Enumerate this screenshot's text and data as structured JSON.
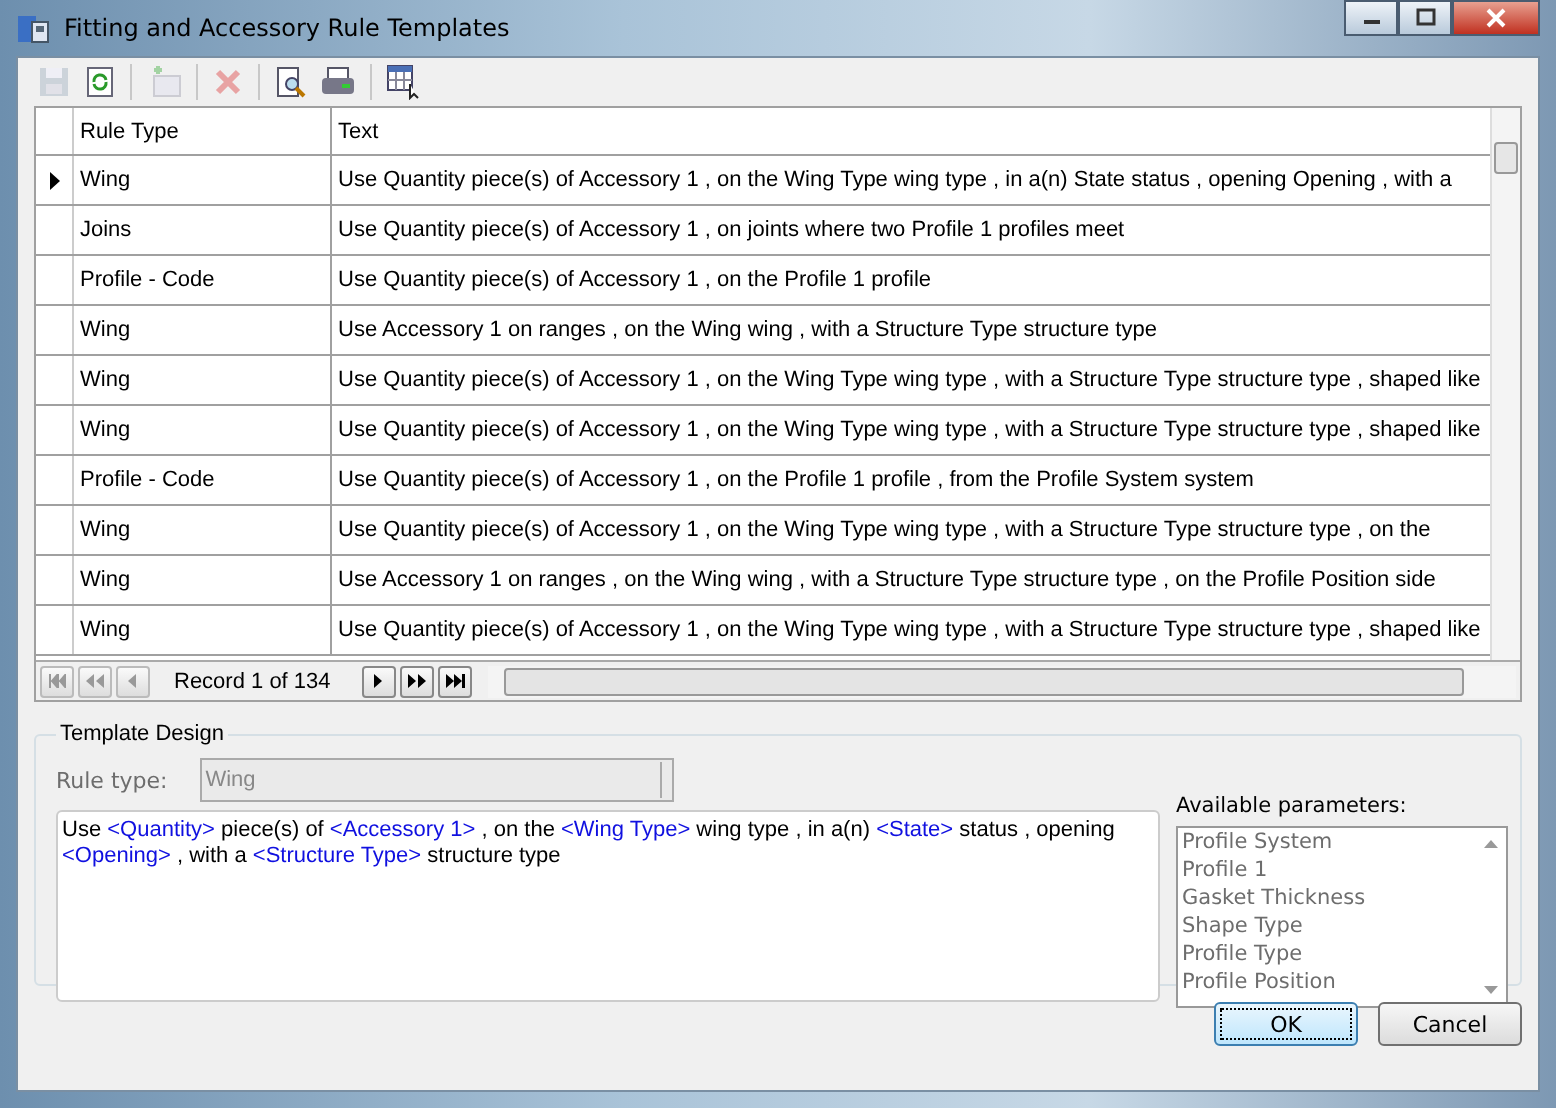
{
  "window": {
    "title": "Fitting and Accessory Rule Templates"
  },
  "toolbar": [
    {
      "kind": "save",
      "disabled": true
    },
    {
      "kind": "refresh",
      "disabled": false
    },
    {
      "kind": "separator"
    },
    {
      "kind": "add",
      "disabled": true
    },
    {
      "kind": "separator"
    },
    {
      "kind": "delete",
      "disabled": true
    },
    {
      "kind": "separator"
    },
    {
      "kind": "preview",
      "disabled": false
    },
    {
      "kind": "print",
      "disabled": false
    },
    {
      "kind": "separator"
    },
    {
      "kind": "columns",
      "disabled": false
    }
  ],
  "table": {
    "columns": [
      "Rule Type",
      "Text"
    ],
    "rows": [
      {
        "rule_type": "Wing",
        "text": "Use Quantity piece(s) of Accessory 1 , on the Wing Type wing type , in a(n) State status , opening Opening , with a",
        "selected": true
      },
      {
        "rule_type": "Joins",
        "text": "Use Quantity piece(s) of Accessory 1 , on joints where two Profile 1 profiles meet",
        "selected": false
      },
      {
        "rule_type": "Profile - Code",
        "text": "Use Quantity piece(s) of Accessory 1 , on the Profile 1 profile",
        "selected": false
      },
      {
        "rule_type": "Wing",
        "text": "Use Accessory 1 on ranges , on the Wing wing , with a Structure Type structure type",
        "selected": false
      },
      {
        "rule_type": "Wing",
        "text": "Use Quantity piece(s) of Accessory 1 , on the Wing Type wing type , with a Structure Type structure type , shaped like",
        "selected": false
      },
      {
        "rule_type": "Wing",
        "text": "Use Quantity piece(s) of Accessory 1 , on the Wing Type wing type , with a Structure Type structure type , shaped like",
        "selected": false
      },
      {
        "rule_type": "Profile - Code",
        "text": "Use Quantity piece(s) of Accessory 1 , on the Profile 1 profile , from the Profile System system",
        "selected": false
      },
      {
        "rule_type": "Wing",
        "text": "Use Quantity piece(s) of Accessory 1 , on the Wing Type wing type , with a Structure Type structure type , on the",
        "selected": false
      },
      {
        "rule_type": "Wing",
        "text": "Use Accessory 1 on ranges , on the Wing wing , with a Structure Type structure type , on the Profile Position side",
        "selected": false
      },
      {
        "rule_type": "Wing",
        "text": "Use Quantity piece(s) of Accessory 1 , on the Wing Type wing type , with a Structure Type structure type , shaped like",
        "selected": false
      }
    ],
    "record_label": "Record 1 of 134"
  },
  "template_design": {
    "title": "Template Design",
    "rule_type_label": "Rule type:",
    "rule_type_value": "Wing",
    "template": [
      {
        "kind": "text",
        "text": "Use "
      },
      {
        "kind": "param",
        "text": "<Quantity>"
      },
      {
        "kind": "text",
        "text": " piece(s) of "
      },
      {
        "kind": "param",
        "text": "<Accessory 1>"
      },
      {
        "kind": "text",
        "text": " , on the "
      },
      {
        "kind": "param",
        "text": "<Wing Type>"
      },
      {
        "kind": "text",
        "text": " wing type , in a(n) "
      },
      {
        "kind": "param",
        "text": "<State>"
      },
      {
        "kind": "text",
        "text": " status , opening "
      },
      {
        "kind": "param",
        "text": "<Opening>"
      },
      {
        "kind": "text",
        "text": " , with a "
      },
      {
        "kind": "param",
        "text": "<Structure Type>"
      },
      {
        "kind": "text",
        "text": " structure type"
      }
    ],
    "parameters_label": "Available parameters:",
    "parameters": [
      "Profile System",
      "Profile 1",
      "Gasket Thickness",
      "Shape Type",
      "Profile Type",
      "Profile Position"
    ]
  },
  "buttons": [
    {
      "label": "OK",
      "default": true
    },
    {
      "label": "Cancel",
      "default": false
    }
  ]
}
